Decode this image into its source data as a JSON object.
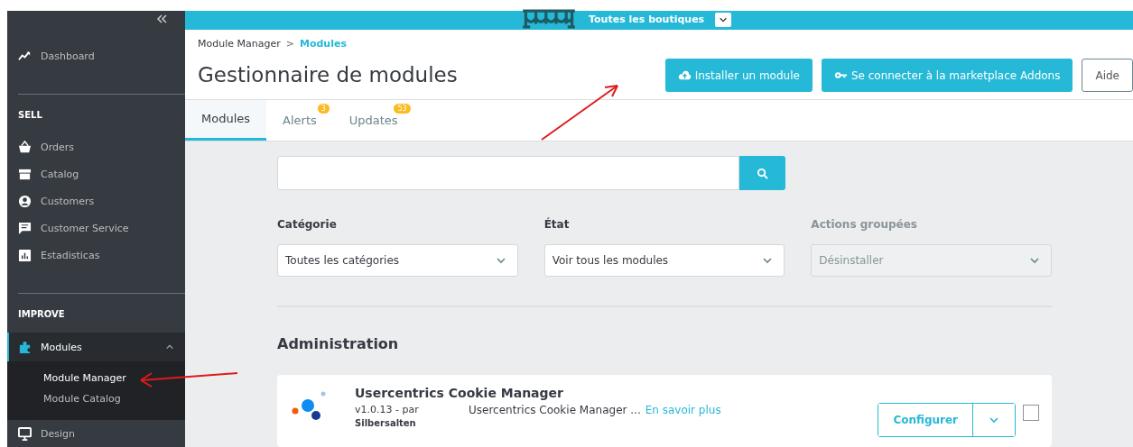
{
  "topbar": {
    "shop_label": "Toutes les boutiques"
  },
  "sidebar": {
    "items": [
      {
        "kind": "link",
        "label": "Dashboard",
        "selected": false
      },
      {
        "kind": "divider"
      },
      {
        "kind": "section",
        "label": "SELL"
      },
      {
        "kind": "link",
        "label": "Orders",
        "selected": false
      },
      {
        "kind": "link",
        "label": "Catalog",
        "selected": false
      },
      {
        "kind": "link",
        "label": "Customers",
        "selected": false
      },
      {
        "kind": "link",
        "label": "Customer Service",
        "selected": false
      },
      {
        "kind": "link",
        "label": "Estadisticas",
        "selected": false
      },
      {
        "kind": "divider"
      },
      {
        "kind": "section",
        "label": "IMPROVE"
      },
      {
        "kind": "group",
        "label": "Modules",
        "selected": true,
        "expanded": true,
        "children": [
          {
            "label": "Module Manager",
            "selected": true
          },
          {
            "label": "Module Catalog",
            "selected": false
          }
        ]
      },
      {
        "kind": "link",
        "label": "Design",
        "selected": false
      }
    ]
  },
  "header": {
    "breadcrumb": [
      {
        "label": "Module Manager",
        "current": false
      },
      {
        "label": "Modules",
        "current": true
      }
    ],
    "separator": ">",
    "title": "Gestionnaire de modules",
    "buttons": [
      {
        "label": "Installer un module",
        "kind": "primary"
      },
      {
        "label": "Se connecter à la marketplace Addons",
        "kind": "primary"
      },
      {
        "label": "Aide",
        "kind": "outline"
      }
    ]
  },
  "tabs": [
    {
      "label": "Modules",
      "selected": true
    },
    {
      "label": "Alerts",
      "selected": false,
      "badge": "3"
    },
    {
      "label": "Updates",
      "selected": false,
      "badge": "53"
    }
  ],
  "filters": [
    {
      "label": "Catégorie",
      "value": "Toutes les catégories",
      "disabled": false
    },
    {
      "label": "État",
      "value": "Voir tous les modules",
      "disabled": false
    },
    {
      "label": "Actions groupées",
      "value": "Désinstaller",
      "disabled": true
    }
  ],
  "section_title": "Administration",
  "modules": [
    {
      "name": "Usercentrics Cookie Manager",
      "version": "v1.0.13 - par",
      "author": "Silbersalten",
      "description": "Usercentrics Cookie Manager ...",
      "more_link": "En savoir plus",
      "action": "Configurer",
      "checked": false
    }
  ]
}
